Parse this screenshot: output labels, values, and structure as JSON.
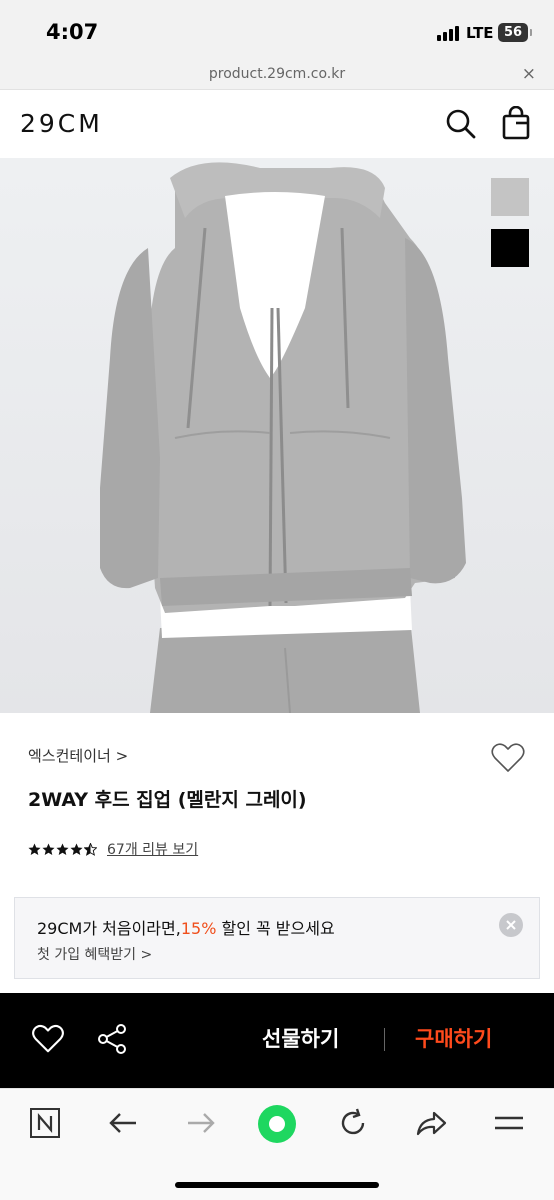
{
  "status_bar": {
    "time": "4:07",
    "network": "LTE",
    "battery": "56"
  },
  "browser": {
    "url": "product.29cm.co.kr",
    "close_symbol": "×"
  },
  "header": {
    "logo": "29CM",
    "search_icon": "search-icon",
    "bag_icon": "shopping-bag-icon"
  },
  "product": {
    "image": "hoodie-photo",
    "swatches": [
      {
        "color": "#c4c4c4"
      },
      {
        "color": "#000000"
      }
    ],
    "brand": "엑스컨테이너",
    "brand_chevron": ">",
    "title": "2WAY 후드 집업 (멜란지 그레이)",
    "rating": 4.5,
    "review_link": "67개 리뷰 보기"
  },
  "promo": {
    "text_before": "29CM가 처음이라면,",
    "percent": "15%",
    "text_after": " 할인 꼭 받으세요",
    "sub": "첫 가입 혜택받기 >"
  },
  "actions": {
    "gift": "선물하기",
    "buy": "구매하기",
    "buy_color": "#ff4a1c"
  },
  "toolbar": {
    "icons": [
      "naver-n-icon",
      "back-arrow-icon",
      "forward-arrow-icon",
      "home-circle-icon",
      "refresh-icon",
      "share-icon",
      "menu-icon"
    ],
    "accent": "#1ed760"
  }
}
